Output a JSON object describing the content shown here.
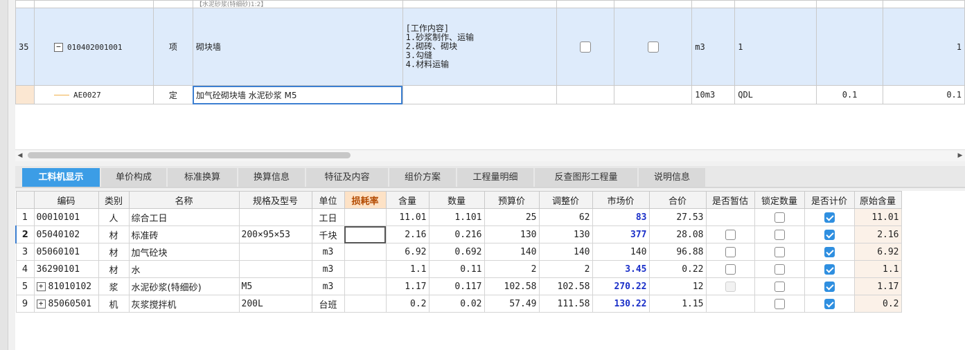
{
  "top_grid": {
    "prev_row_fragment": "【水泥砂浆(特细砂)1:2】",
    "row35": {
      "num": "35",
      "expander": "−",
      "code": "010402001001",
      "type": "项",
      "name": "砌块墙",
      "content_lines": [
        "[工作内容]",
        "1.砂浆制作、运输",
        "2.砌砖、砌块",
        "3.勾缝",
        "4.材料运输"
      ],
      "unit": "m3",
      "qty_expr": "1",
      "qty": "1"
    },
    "row_sub": {
      "code": "AE0027",
      "type": "定",
      "name": "加气砼砌块墙 水泥砂浆 M5",
      "unit": "10m3",
      "qty_expr": "QDL",
      "qty1": "0.1",
      "qty2": "0.1"
    }
  },
  "tabs": [
    "工料机显示",
    "单价构成",
    "标准换算",
    "换算信息",
    "特征及内容",
    "组价方案",
    "工程量明细",
    "反查图形工程量",
    "说明信息"
  ],
  "active_tab": "工料机显示",
  "bottom_table": {
    "headers": [
      "",
      "编码",
      "类别",
      "名称",
      "规格及型号",
      "单位",
      "损耗率",
      "含量",
      "数量",
      "预算价",
      "调整价",
      "市场价",
      "合价",
      "是否暂估",
      "锁定数量",
      "是否计价",
      "原始含量"
    ],
    "rows": [
      {
        "no": "1",
        "expander": "",
        "code": "00010101",
        "cat": "人",
        "name": "综合工日",
        "spec": "",
        "unit": "工日",
        "loss": "",
        "content": "11.01",
        "qty": "1.101",
        "budget": "25",
        "adjust": "62",
        "market": "83",
        "total": "27.53",
        "orig": "11.01"
      },
      {
        "no": "2",
        "expander": "",
        "code": "05040102",
        "cat": "材",
        "name": "标准砖",
        "spec": "200×95×53",
        "unit": "千块",
        "loss": "",
        "content": "2.16",
        "qty": "0.216",
        "budget": "130",
        "adjust": "130",
        "market": "377",
        "total": "28.08",
        "orig": "2.16"
      },
      {
        "no": "3",
        "expander": "",
        "code": "05060101",
        "cat": "材",
        "name": "加气砼块",
        "spec": "",
        "unit": "m3",
        "loss": "",
        "content": "6.92",
        "qty": "0.692",
        "budget": "140",
        "adjust": "140",
        "market": "140",
        "total": "96.88",
        "orig": "6.92"
      },
      {
        "no": "4",
        "expander": "",
        "code": "36290101",
        "cat": "材",
        "name": "水",
        "spec": "",
        "unit": "m3",
        "loss": "",
        "content": "1.1",
        "qty": "0.11",
        "budget": "2",
        "adjust": "2",
        "market": "3.45",
        "total": "0.22",
        "orig": "1.1"
      },
      {
        "no": "5",
        "expander": "+",
        "code": "81010102",
        "cat": "浆",
        "name": "水泥砂浆(特细砂)",
        "spec": "M5",
        "unit": "m3",
        "loss": "",
        "content": "1.17",
        "qty": "0.117",
        "budget": "102.58",
        "adjust": "102.58",
        "market": "270.22",
        "total": "12",
        "orig": "1.17"
      },
      {
        "no": "9",
        "expander": "+",
        "code": "85060501",
        "cat": "机",
        "name": "灰浆搅拌机",
        "spec": "200L",
        "unit": "台班",
        "loss": "",
        "content": "0.2",
        "qty": "0.02",
        "budget": "57.49",
        "adjust": "111.58",
        "market": "130.22",
        "total": "1.15",
        "orig": "0.2"
      }
    ]
  },
  "colors": {
    "accent": "#3c9de6",
    "selected_row": "#deebfb",
    "market_blue": "#1a2fc8",
    "highlight_header": "#fde2c6"
  }
}
